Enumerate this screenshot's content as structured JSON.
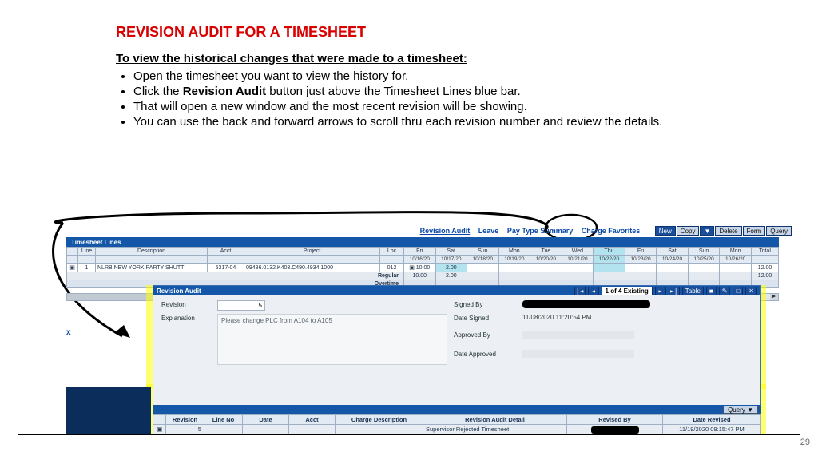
{
  "slide": {
    "title": "REVISION AUDIT FOR A TIMESHEET",
    "subhead": "To view the historical changes that were made to a timesheet:",
    "bullets": [
      "Open the timesheet you want to view the history for.",
      "Click the __B_START__Revision Audit__B_END__ button just above the Timesheet Lines blue bar.",
      "That will open a new window and the most recent revision will be showing.",
      "You can use the back and forward arrows to scroll thru each revision number and review the details."
    ],
    "pagenum": "29"
  },
  "links": {
    "revision_audit": "Revision Audit",
    "leave": "Leave",
    "paytype": "Pay Type Summary",
    "chargefav": "Charge Favorites",
    "btns": [
      "New",
      "Copy",
      "▼",
      "Delete",
      "Form",
      "Query"
    ]
  },
  "timesheet": {
    "bar_label": "Timesheet Lines",
    "headers_top": [
      "",
      "Line",
      "Description",
      "Acct",
      "Project",
      "Loc"
    ],
    "day_cols": [
      {
        "d": "Fri",
        "dt": "10/16/20"
      },
      {
        "d": "Sat",
        "dt": "10/17/20"
      },
      {
        "d": "Sun",
        "dt": "10/18/20"
      },
      {
        "d": "Mon",
        "dt": "10/19/20"
      },
      {
        "d": "Tue",
        "dt": "10/20/20"
      },
      {
        "d": "Wed",
        "dt": "10/21/20"
      },
      {
        "d": "Thu",
        "dt": "10/22/20"
      },
      {
        "d": "Fri",
        "dt": "10/23/20"
      },
      {
        "d": "Sat",
        "dt": "10/24/20"
      },
      {
        "d": "Sun",
        "dt": "10/25/20"
      },
      {
        "d": "Mon",
        "dt": "10/26/20"
      }
    ],
    "total_header": "Total",
    "row": {
      "line": "1",
      "description": "NLRB NEW YORK PARTY SHUTT",
      "acct": "5317-04",
      "project": "09486.0132.K403.C490.4934.1000",
      "loc": "012",
      "fri1": "10.00",
      "sat1": "2.00",
      "total": "12.00"
    },
    "regular_label": "Regular",
    "regular_vals": {
      "fri1": "10.00",
      "sat1": "2.00",
      "total": "12.00"
    },
    "overtime_label": "Overtime"
  },
  "audit": {
    "bar_label": "Revision Audit",
    "counter": "1 of 4 Existing",
    "nav": {
      "first": "|◄",
      "prev": "◄",
      "next": "►",
      "last": "►|"
    },
    "table_btn": "Table",
    "revision_label": "Revision",
    "revision_value": "5",
    "explanation_label": "Explanation",
    "explanation_value": "Please change PLC from A104 to A105",
    "signed_by_label": "Signed By",
    "date_signed_label": "Date Signed",
    "date_signed_value": "11/08/2020 11:20:54 PM",
    "approved_by_label": "Approved By",
    "date_approved_label": "Date Approved"
  },
  "detail": {
    "query_btn": "Query  ▼",
    "headers": [
      "",
      "Revision",
      "Line No",
      "Date",
      "Acct",
      "Charge Description",
      "Revision Audit Detail",
      "Revised By",
      "Date Revised"
    ],
    "row": {
      "revision": "5",
      "detail": "Supervisor Rejected Timesheet",
      "date_revised": "11/19/2020 09:15:47 PM"
    }
  },
  "annotation": {
    "x_mark": "x"
  }
}
